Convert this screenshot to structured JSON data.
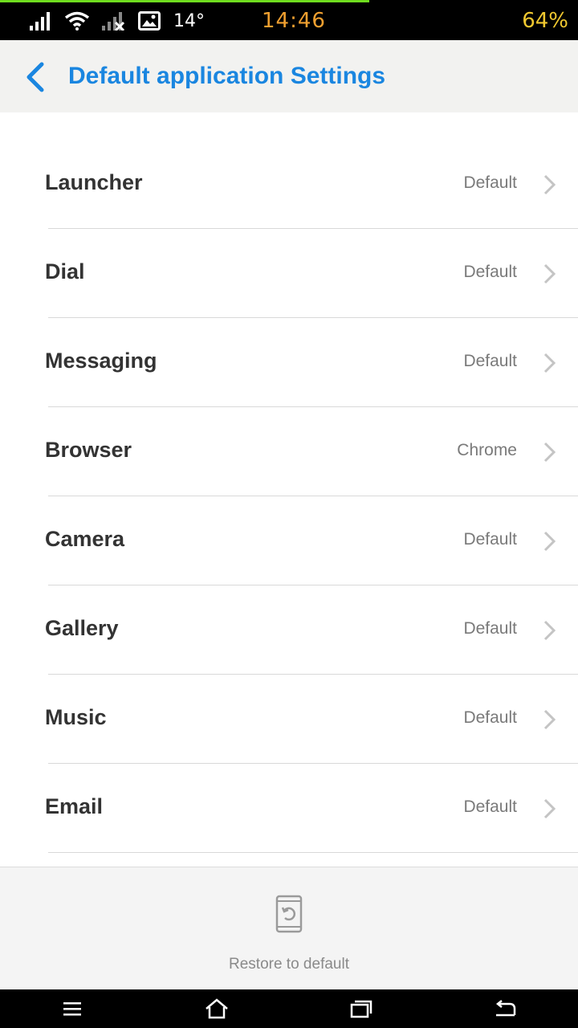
{
  "status_bar": {
    "temperature": "14°",
    "time": "14:46",
    "battery": "64%",
    "icons": [
      "signal-icon",
      "wifi-icon",
      "no-signal-icon",
      "image-notification-icon"
    ]
  },
  "header": {
    "title": "Default application Settings",
    "back_icon": "back-chevron-icon",
    "accent_color": "#1a86e0"
  },
  "settings": [
    {
      "label": "Launcher",
      "value": "Default"
    },
    {
      "label": "Dial",
      "value": "Default"
    },
    {
      "label": "Messaging",
      "value": "Default"
    },
    {
      "label": "Browser",
      "value": "Chrome"
    },
    {
      "label": "Camera",
      "value": "Default"
    },
    {
      "label": "Gallery",
      "value": "Default"
    },
    {
      "label": "Music",
      "value": "Default"
    },
    {
      "label": "Email",
      "value": "Default"
    }
  ],
  "footer": {
    "restore_label": "Restore to default",
    "restore_icon": "restore-phone-icon"
  },
  "nav_bar": {
    "icons": [
      "menu-icon",
      "home-icon",
      "recent-apps-icon",
      "back-icon"
    ]
  }
}
